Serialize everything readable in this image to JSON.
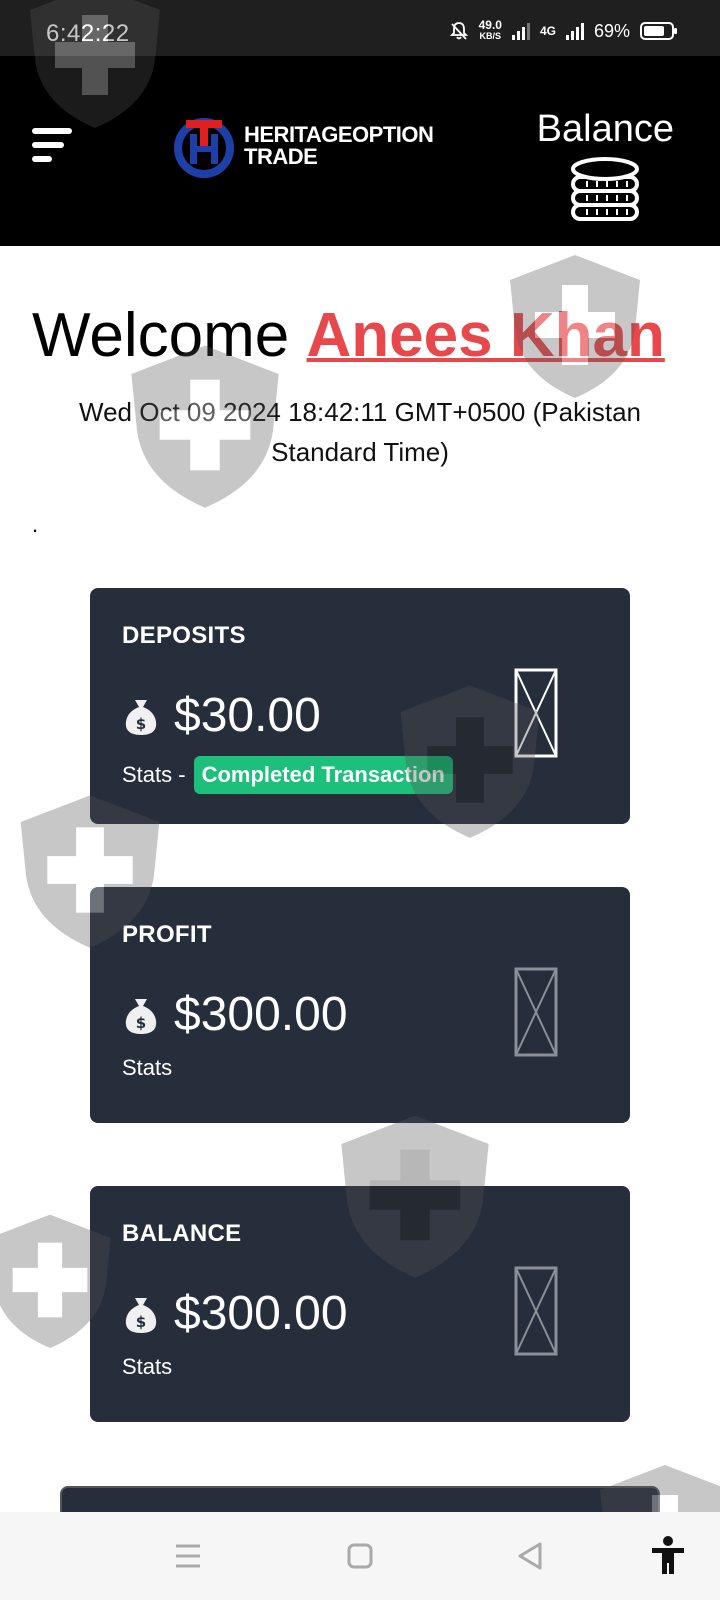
{
  "status_bar": {
    "time": "6:42:22",
    "net_speed": "49.0",
    "net_unit": "KB/S",
    "network": "4G",
    "battery": "69%"
  },
  "header": {
    "logo_line1": "HERITAGEOPTION",
    "logo_line2": "TRADE",
    "balance_label": "Balance",
    "balance_icon": "coins-stack-icon",
    "menu_icon": "hamburger-menu-icon"
  },
  "welcome": {
    "greeting": "Welcome",
    "user_name": "Anees Khan",
    "datetime": "Wed Oct 09 2024 18:42:11 GMT+0500 (Pakistan Standard Time)",
    "dot": "."
  },
  "cards": [
    {
      "title": "DEPOSITS",
      "amount": "$30.00",
      "stats": "Stats -",
      "badge": "Completed Transaction"
    },
    {
      "title": "PROFIT",
      "amount": "$300.00",
      "stats": "Stats"
    },
    {
      "title": "BALANCE",
      "amount": "$300.00",
      "stats": "Stats"
    }
  ],
  "colors": {
    "accent_name": "#e8484c",
    "card_bg": "#262d3b",
    "badge_bg": "#1cc07a"
  },
  "nav": {
    "menu_icon": "recent-apps-icon",
    "home_icon": "home-square-icon",
    "back_icon": "back-triangle-icon",
    "accessibility_icon": "accessibility-icon"
  }
}
